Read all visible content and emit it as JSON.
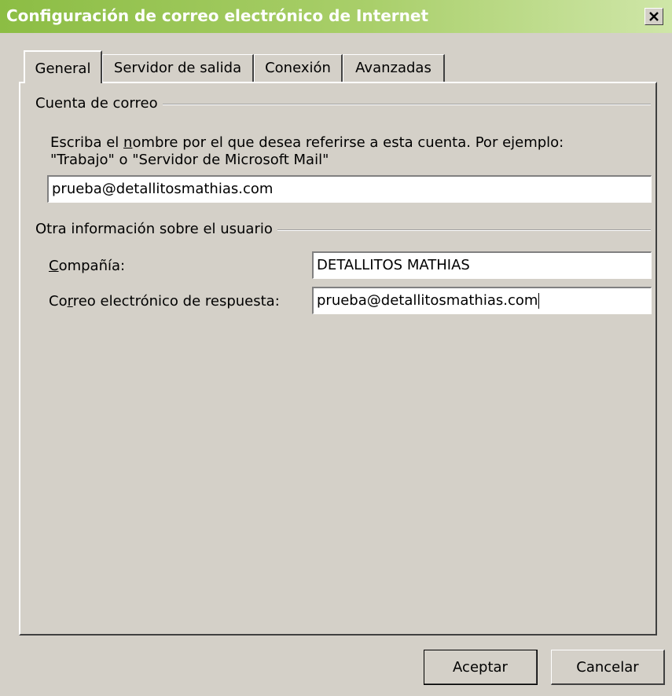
{
  "window": {
    "title": "Configuración de correo electrónico de Internet",
    "close_label": "×"
  },
  "tabs": [
    {
      "label": "General",
      "active": true
    },
    {
      "label": "Servidor de salida",
      "active": false
    },
    {
      "label": "Conexión",
      "active": false
    },
    {
      "label": "Avanzadas",
      "active": false
    }
  ],
  "account_group": {
    "title": "Cuenta de correo",
    "desc_before": "Escriba el ",
    "desc_accel": "n",
    "desc_after": "ombre por el que desea referirse a esta cuenta. Por ejemplo:",
    "desc_line2": "\"Trabajo\" o \"Servidor de Microsoft Mail\"",
    "account_name_value": "prueba@detallitosmathias.com"
  },
  "user_group": {
    "title": "Otra información sobre el usuario",
    "company_label_accel": "C",
    "company_label_rest": "ompañía:",
    "company_value": "DETALLITOS MATHIAS",
    "reply_label_before": "Co",
    "reply_label_accel": "r",
    "reply_label_after": "reo electrónico de respuesta:",
    "reply_value": "prueba@detallitosmathias.com"
  },
  "buttons": {
    "ok": "Aceptar",
    "cancel": "Cancelar"
  }
}
